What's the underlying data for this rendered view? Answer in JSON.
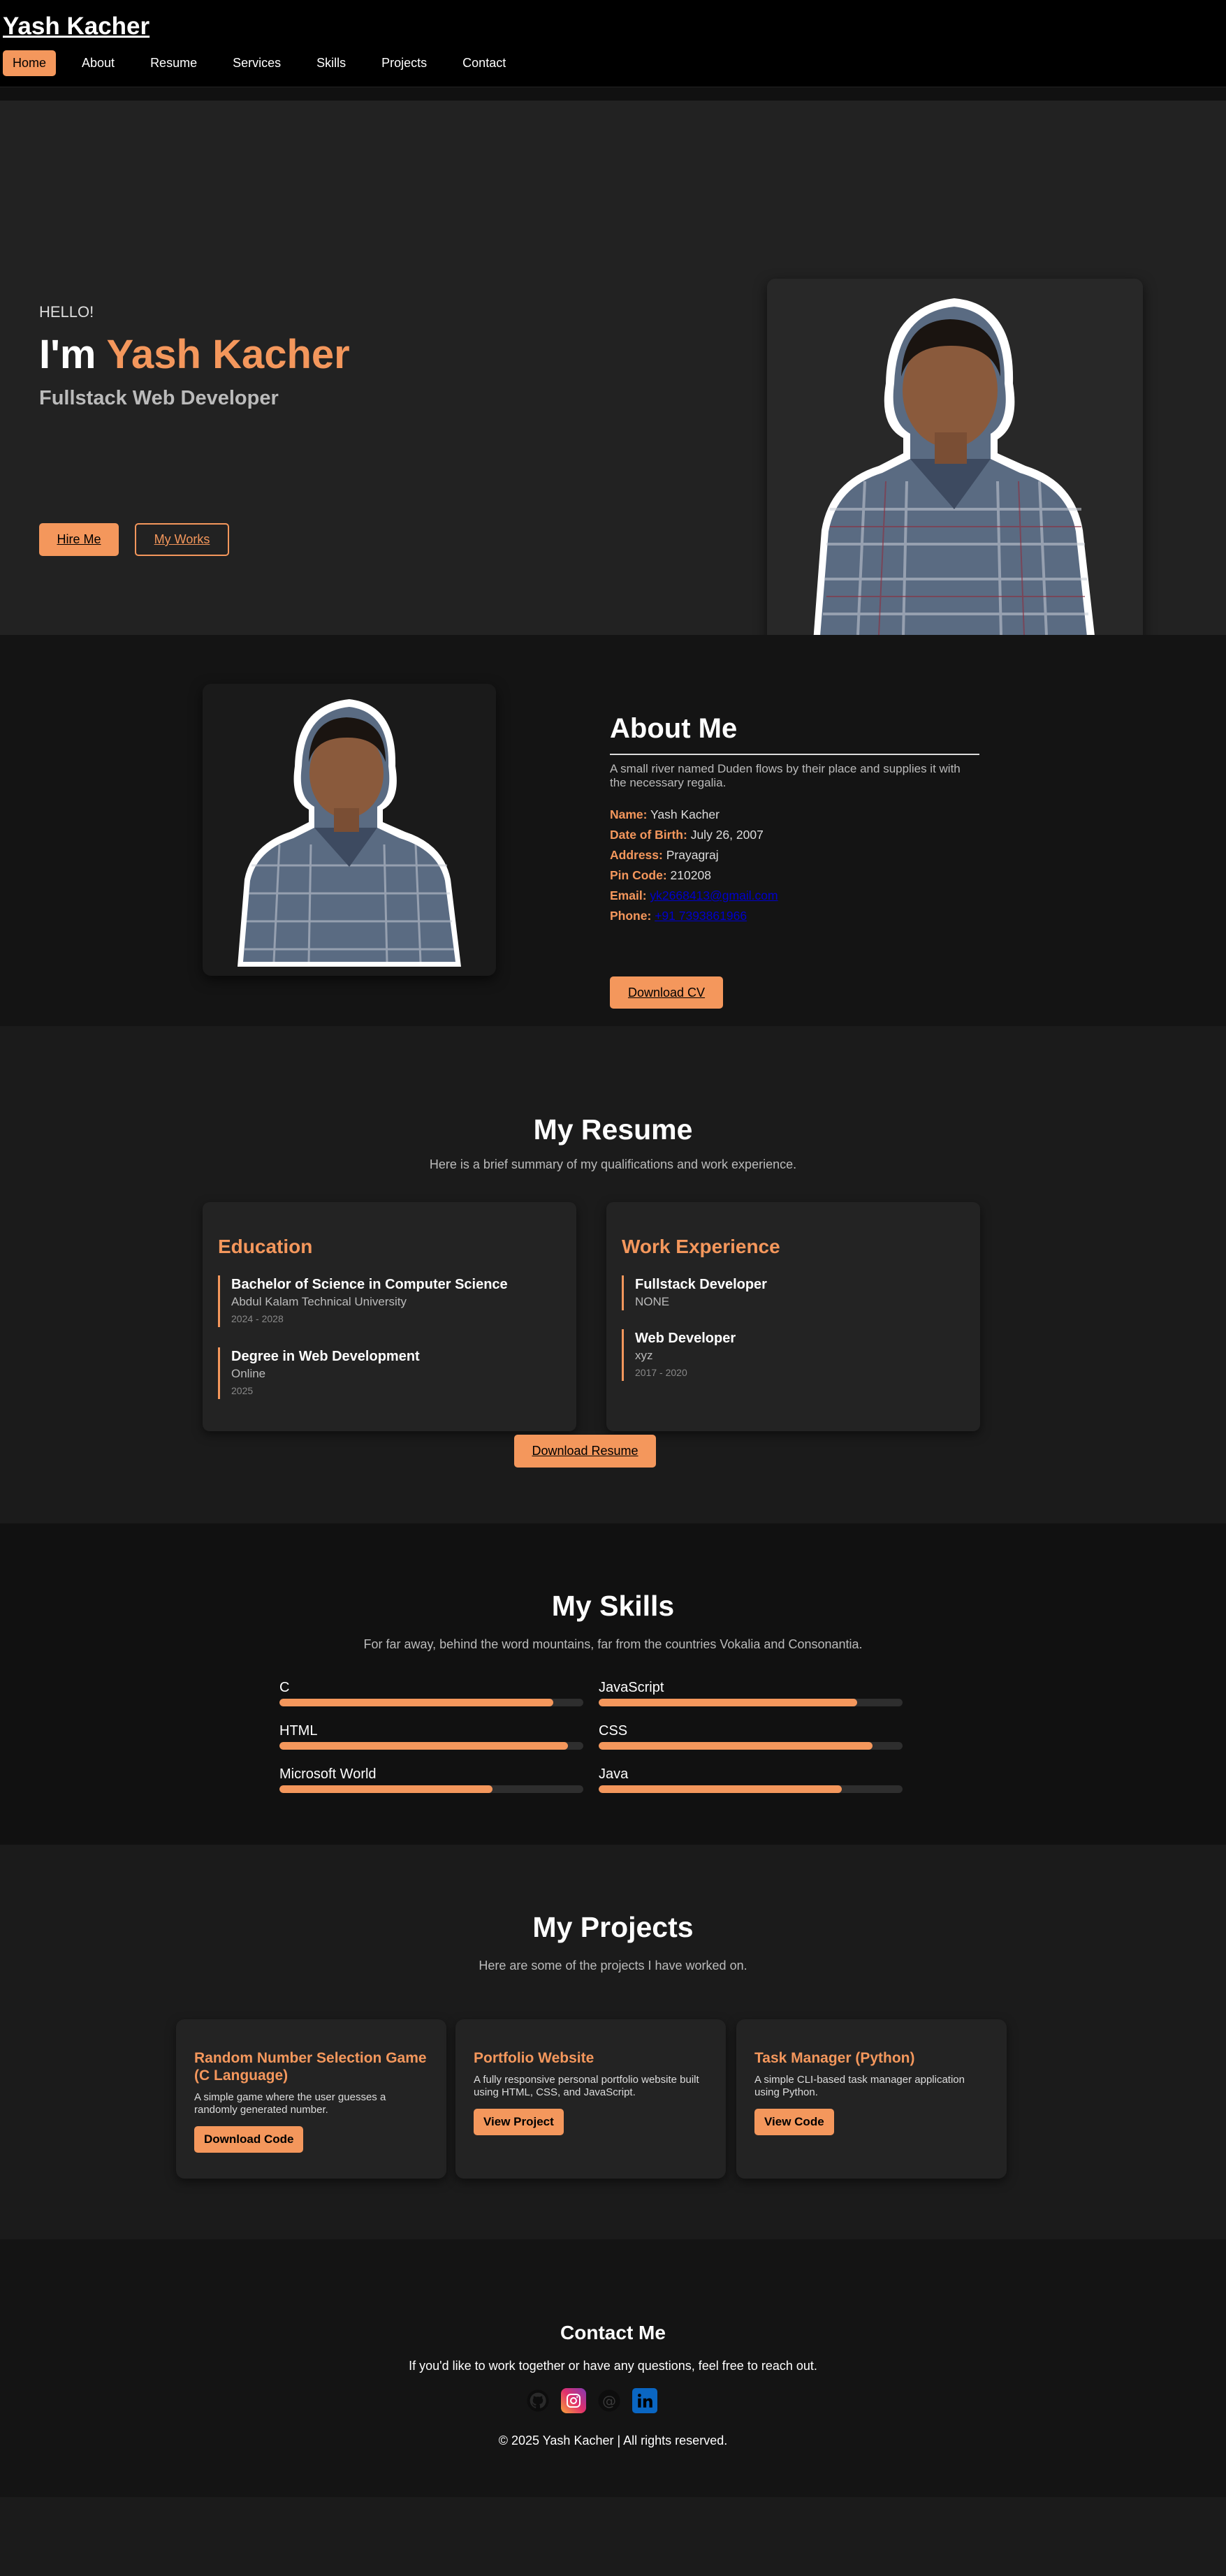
{
  "header": {
    "logo": "Yash Kacher",
    "nav": [
      "Home",
      "About",
      "Resume",
      "Services",
      "Skills",
      "Projects",
      "Contact"
    ]
  },
  "hero": {
    "hello": "HELLO!",
    "title_prefix": "I'm ",
    "title_name": "Yash Kacher",
    "subtitle": "Fullstack Web Developer",
    "hire_label": "Hire Me",
    "works_label": "My Works"
  },
  "about": {
    "title": "About Me",
    "description": "A small river named Duden flows by their place and supplies it with the necessary regalia.",
    "info": [
      {
        "label": "Name:",
        "value": "Yash Kacher"
      },
      {
        "label": "Date of Birth:",
        "value": "July 26, 2007"
      },
      {
        "label": "Address:",
        "value": "Prayagraj"
      },
      {
        "label": "Pin Code:",
        "value": "210208"
      },
      {
        "label": "Email:",
        "value": "yk2668413@gmail.com"
      },
      {
        "label": "Phone:",
        "value": "+91 7393861966"
      }
    ],
    "cv_label": "Download CV"
  },
  "resume": {
    "title": "My Resume",
    "subtitle": "Here is a brief summary of my qualifications and work experience.",
    "education_heading": "Education",
    "education": [
      {
        "title": "Bachelor of Science in Computer Science",
        "org": "Abdul Kalam Technical University",
        "date": "2024 - 2028"
      },
      {
        "title": "Degree in Web Development",
        "org": "Online",
        "date": "2025"
      }
    ],
    "work_heading": "Work Experience",
    "work": [
      {
        "title": "Fullstack Developer",
        "org": "NONE",
        "date": ""
      },
      {
        "title": "Web Developer",
        "org": "xyz",
        "date": "2017 - 2020"
      }
    ],
    "download_label": "Download Resume"
  },
  "skills": {
    "title": "My Skills",
    "subtitle": "For far away, behind the word mountains, far from the countries Vokalia and Consonantia.",
    "items": [
      {
        "name": "C",
        "percent": 90
      },
      {
        "name": "JavaScript",
        "percent": 85
      },
      {
        "name": "HTML",
        "percent": 95
      },
      {
        "name": "CSS",
        "percent": 90
      },
      {
        "name": "Microsoft World",
        "percent": 70
      },
      {
        "name": "Java",
        "percent": 80
      }
    ]
  },
  "projects": {
    "title": "My Projects",
    "subtitle": "Here are some of the projects I have worked on.",
    "items": [
      {
        "title": "Random Number Selection Game (C Language)",
        "desc": "A simple game where the user guesses a randomly generated number.",
        "button": "Download Code"
      },
      {
        "title": "Portfolio Website",
        "desc": "A fully responsive personal portfolio website built using HTML, CSS, and JavaScript.",
        "button": "View Project"
      },
      {
        "title": "Task Manager (Python)",
        "desc": "A simple CLI-based task manager application using Python.",
        "button": "View Code"
      }
    ]
  },
  "contact": {
    "title": "Contact Me",
    "subtitle": "If you'd like to work together or have any questions, feel free to reach out.",
    "social": [
      "github-icon",
      "instagram-icon",
      "threads-icon",
      "linkedin-icon"
    ],
    "copyright": "© 2025 Yash Kacher | All rights reserved."
  },
  "colors": {
    "accent": "#f4975c",
    "background": "#1b1b1b",
    "header": "#000000"
  }
}
